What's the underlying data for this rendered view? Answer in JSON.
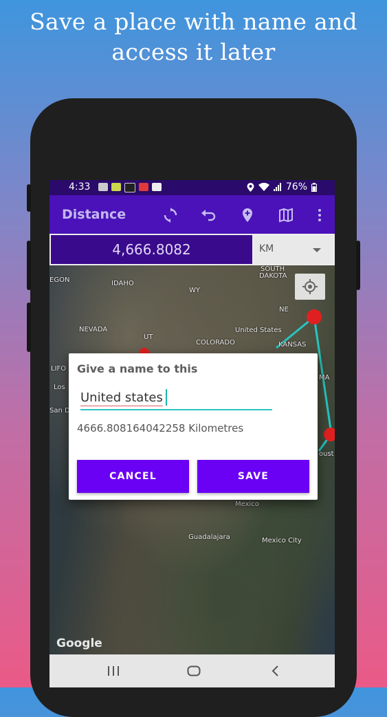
{
  "promo": {
    "line1": "Save a place with name and",
    "line2": "access it later"
  },
  "status_bar": {
    "time": "4:33",
    "battery": "76%"
  },
  "app_bar": {
    "title": "Distance"
  },
  "distance_row": {
    "value": "4,666.8082",
    "unit": "KM"
  },
  "map": {
    "labels": [
      "SOUTH",
      "DAKOTA",
      "EGON",
      "IDAHO",
      "WY",
      "NE",
      "NEVADA",
      "UT",
      "United States",
      "COLORADO",
      "KANSAS",
      "LIFO",
      "Los",
      "San D",
      "MA",
      "oust",
      "Mexico",
      "Guadalajara",
      "Mexico City"
    ],
    "attribution": "Google"
  },
  "dialog": {
    "title": "Give a name to this",
    "name_value": "United states",
    "distance_text": "4666.808164042258 Kilometres",
    "cancel_label": "CANCEL",
    "save_label": "SAVE"
  },
  "colors": {
    "status_bar": "#2a0a6b",
    "app_bar": "#4a12b8",
    "accent": "#6a00f4",
    "route": "#26c6c0",
    "marker": "#e02020"
  }
}
